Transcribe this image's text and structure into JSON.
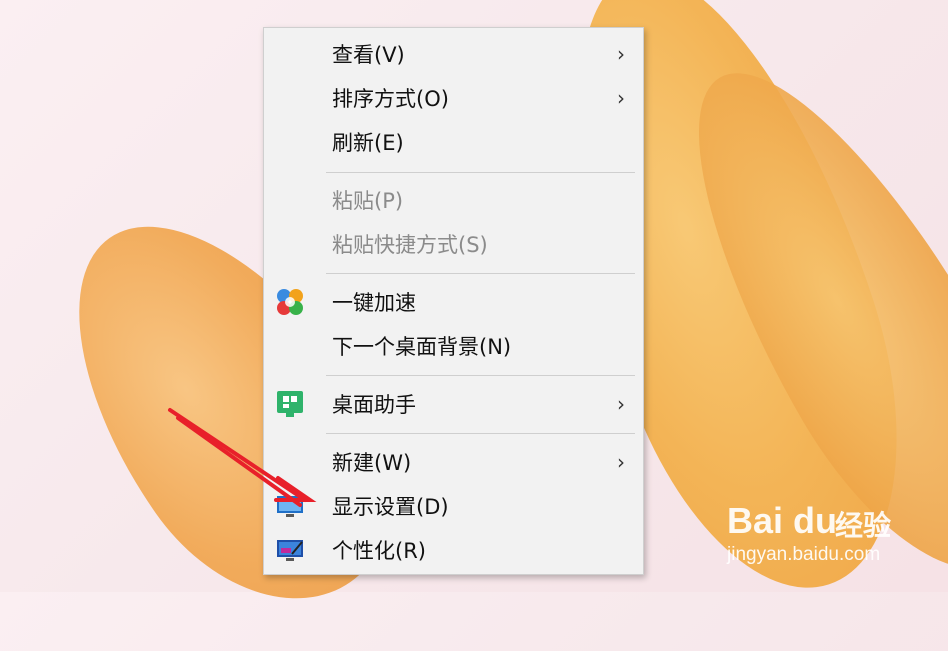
{
  "context_menu": {
    "items": [
      {
        "label": "查看(V)",
        "submenu": true,
        "enabled": true
      },
      {
        "label": "排序方式(O)",
        "submenu": true,
        "enabled": true
      },
      {
        "label": "刷新(E)",
        "submenu": false,
        "enabled": true
      },
      {
        "label": "粘贴(P)",
        "submenu": false,
        "enabled": false
      },
      {
        "label": "粘贴快捷方式(S)",
        "submenu": false,
        "enabled": false
      },
      {
        "label": "一键加速",
        "submenu": false,
        "enabled": true,
        "icon": "speedup-icon"
      },
      {
        "label": "下一个桌面背景(N)",
        "submenu": false,
        "enabled": true
      },
      {
        "label": "桌面助手",
        "submenu": true,
        "enabled": true,
        "icon": "desktop-assistant-icon"
      },
      {
        "label": "新建(W)",
        "submenu": true,
        "enabled": true
      },
      {
        "label": "显示设置(D)",
        "submenu": false,
        "enabled": true,
        "icon": "display-settings-icon"
      },
      {
        "label": "个性化(R)",
        "submenu": false,
        "enabled": true,
        "icon": "personalize-icon"
      }
    ]
  },
  "watermark": {
    "logo": "Bai du",
    "brand_cn": "经验",
    "url": "jingyan.baidu.com"
  },
  "colors": {
    "menu_bg": "#f2f2f2",
    "annotation_arrow": "#e8202a"
  }
}
